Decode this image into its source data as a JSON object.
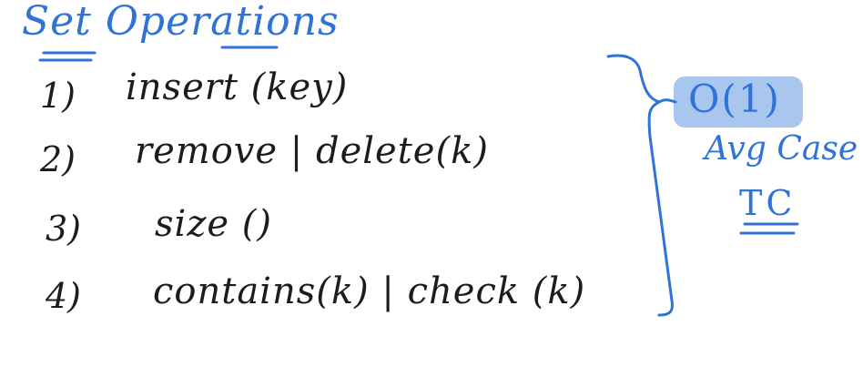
{
  "title": "Set Operations",
  "operations": [
    {
      "number": "1)",
      "text": "insert (key)"
    },
    {
      "number": "2)",
      "text": "remove | delete(k)"
    },
    {
      "number": "3)",
      "text": "size ()"
    },
    {
      "number": "4)",
      "text": "contains(k) | check (k)"
    }
  ],
  "complexity": {
    "value": "O(1)",
    "case_label": "Avg Case",
    "abbrev": "TC"
  },
  "colors": {
    "ink_blue": "#2f73d6",
    "ink_dark": "#1c1c1c",
    "highlight": "#a9c6ef"
  }
}
